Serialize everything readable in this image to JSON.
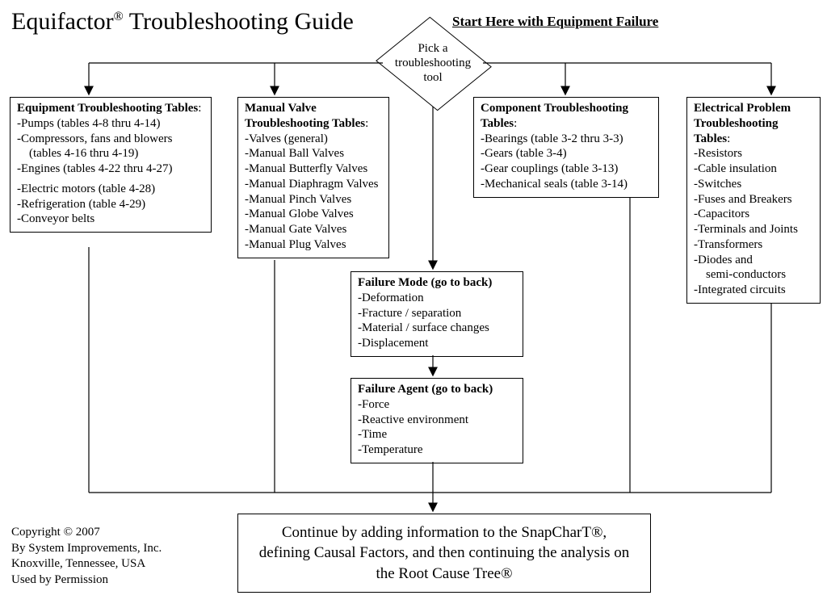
{
  "title_prefix": "Equifactor",
  "title_suffix": " Troubleshooting Guide",
  "start_label": "Start Here with Equipment Failure",
  "diamond_text": "Pick a troubleshooting tool",
  "box_equipment": {
    "heading": "Equipment Troubleshooting Tables",
    "items_top": [
      "-Pumps  (tables 4-8 thru 4-14)",
      "-Compressors, fans and blowers",
      "    (tables 4-16 thru 4-19)",
      "-Engines (tables 4-22 thru 4-27)"
    ],
    "items_bottom": [
      "-Electric motors (table 4-28)",
      "-Refrigeration (table 4-29)",
      "-Conveyor belts"
    ]
  },
  "box_valve": {
    "heading": "Manual Valve Troubleshooting Tables",
    "items": [
      "-Valves (general)",
      "-Manual Ball Valves",
      "-Manual Butterfly Valves",
      "-Manual Diaphragm Valves",
      "-Manual Pinch Valves",
      "-Manual Globe Valves",
      "-Manual Gate Valves",
      "-Manual Plug Valves"
    ]
  },
  "box_component": {
    "heading": "Component Troubleshooting Tables",
    "items": [
      "-Bearings  (table 3-2 thru 3-3)",
      "-Gears (table 3-4)",
      "-Gear couplings  (table 3-13)",
      "-Mechanical seals (table 3-14)"
    ]
  },
  "box_electrical": {
    "heading": "Electrical Problem Troubleshooting Tables",
    "items": [
      "-Resistors",
      "-Cable insulation",
      "-Switches",
      "-Fuses and Breakers",
      "-Capacitors",
      "-Terminals and Joints",
      "-Transformers",
      "-Diodes and",
      "    semi-conductors",
      "-Integrated circuits"
    ]
  },
  "box_failure_mode": {
    "heading": "Failure Mode (go to back)",
    "items": [
      "-Deformation",
      "-Fracture /   separation",
      "-Material /  surface changes",
      "-Displacement"
    ]
  },
  "box_failure_agent": {
    "heading": "Failure Agent (go to back)",
    "items": [
      "-Force",
      "-Reactive  environment",
      "-Time",
      "-Temperature"
    ]
  },
  "final_box": "Continue by adding information to the SnapCharT®, defining Causal Factors, and then continuing the analysis on the Root Cause Tree®",
  "copyright": {
    "l1": "Copyright ©  2007",
    "l2": "By System Improvements, Inc.",
    "l3": "Knoxville, Tennessee, USA",
    "l4": "Used by Permission"
  }
}
